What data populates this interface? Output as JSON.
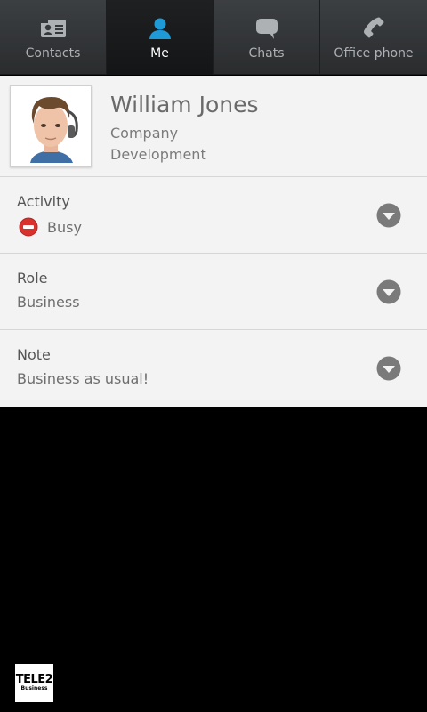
{
  "tabs": [
    {
      "label": "Contacts",
      "icon": "contacts-card-icon",
      "active": false
    },
    {
      "label": "Me",
      "icon": "person-icon",
      "active": true
    },
    {
      "label": "Chats",
      "icon": "chat-bubble-icon",
      "active": false
    },
    {
      "label": "Office phone",
      "icon": "phone-handset-icon",
      "active": false
    }
  ],
  "profile": {
    "name": "William Jones",
    "company": "Company",
    "department": "Development"
  },
  "fields": {
    "activity": {
      "title": "Activity",
      "value": "Busy",
      "status_icon": "busy-status-icon",
      "status_color": "#d9312b"
    },
    "role": {
      "title": "Role",
      "value": "Business"
    },
    "note": {
      "title": "Note",
      "value": "Business as usual!"
    }
  },
  "logo": {
    "line1": "TELE2",
    "line2": "Business"
  },
  "colors": {
    "active_tab_icon": "#1e9ad6",
    "chevron": "#7a7a7a"
  }
}
